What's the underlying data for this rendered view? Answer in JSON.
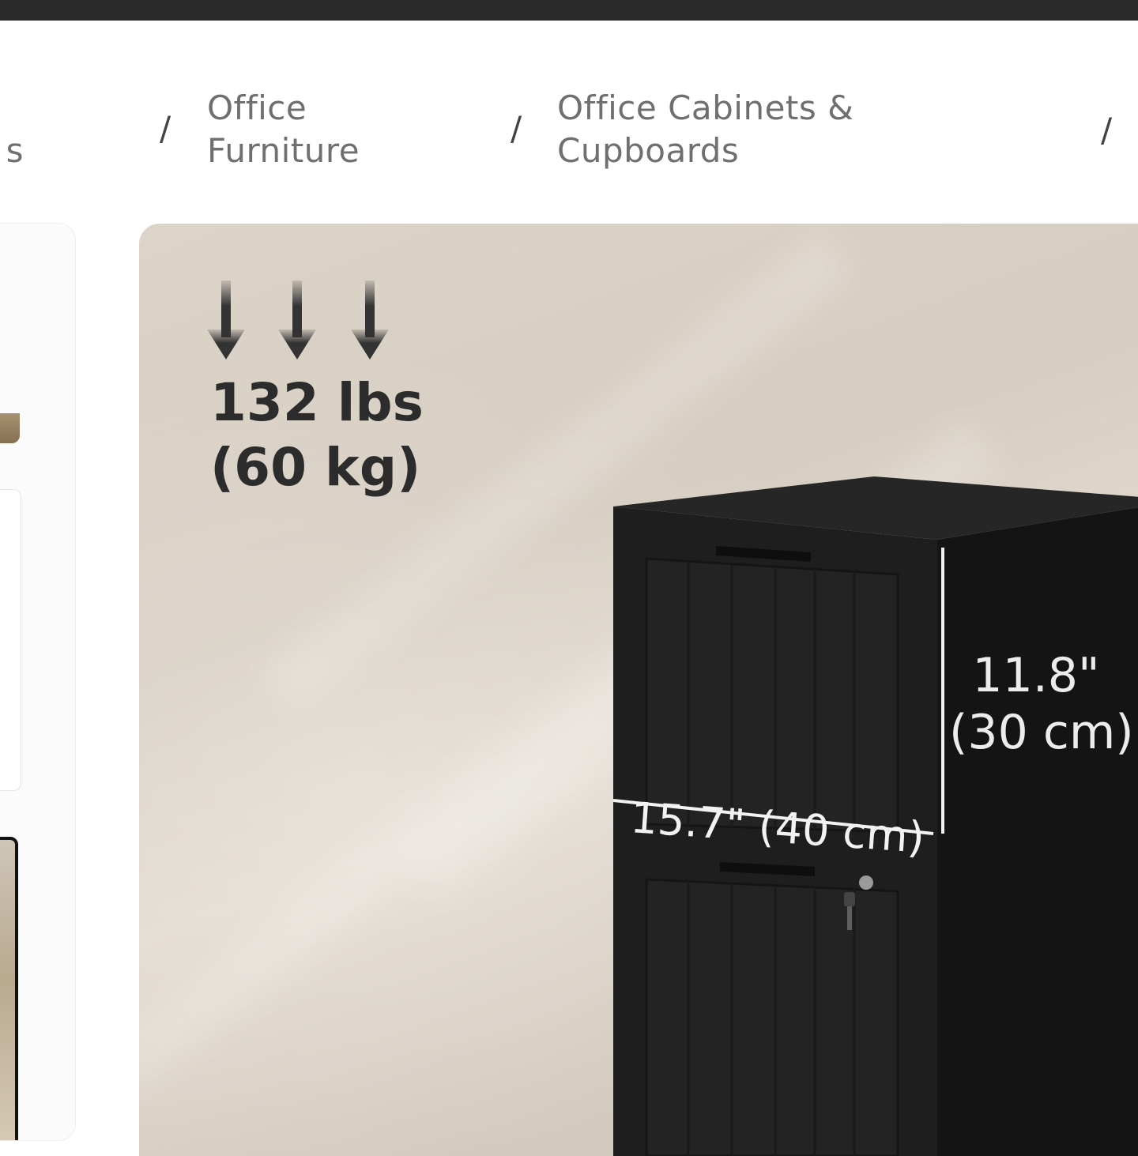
{
  "breadcrumb": {
    "items": [
      {
        "label": "s"
      },
      {
        "label": "Office Furniture"
      },
      {
        "label": "Office Cabinets & Cupboards"
      }
    ],
    "separator": "/"
  },
  "product_image": {
    "weight": {
      "line1": "132 lbs",
      "line2": "(60 kg)"
    },
    "height_dimension": {
      "line1": "11.8\"",
      "line2": "(30 cm)"
    },
    "width_dimension": "15.7\" (40 cm)"
  },
  "icons": {
    "weight_arrows": "down-arrow-icon",
    "lock": "lock-icon"
  },
  "colors": {
    "top_bar": "#2a2a2a",
    "breadcrumb_text": "#6f6f6f",
    "cabinet": "#1f1f1f",
    "background": "#d9d0c5"
  }
}
